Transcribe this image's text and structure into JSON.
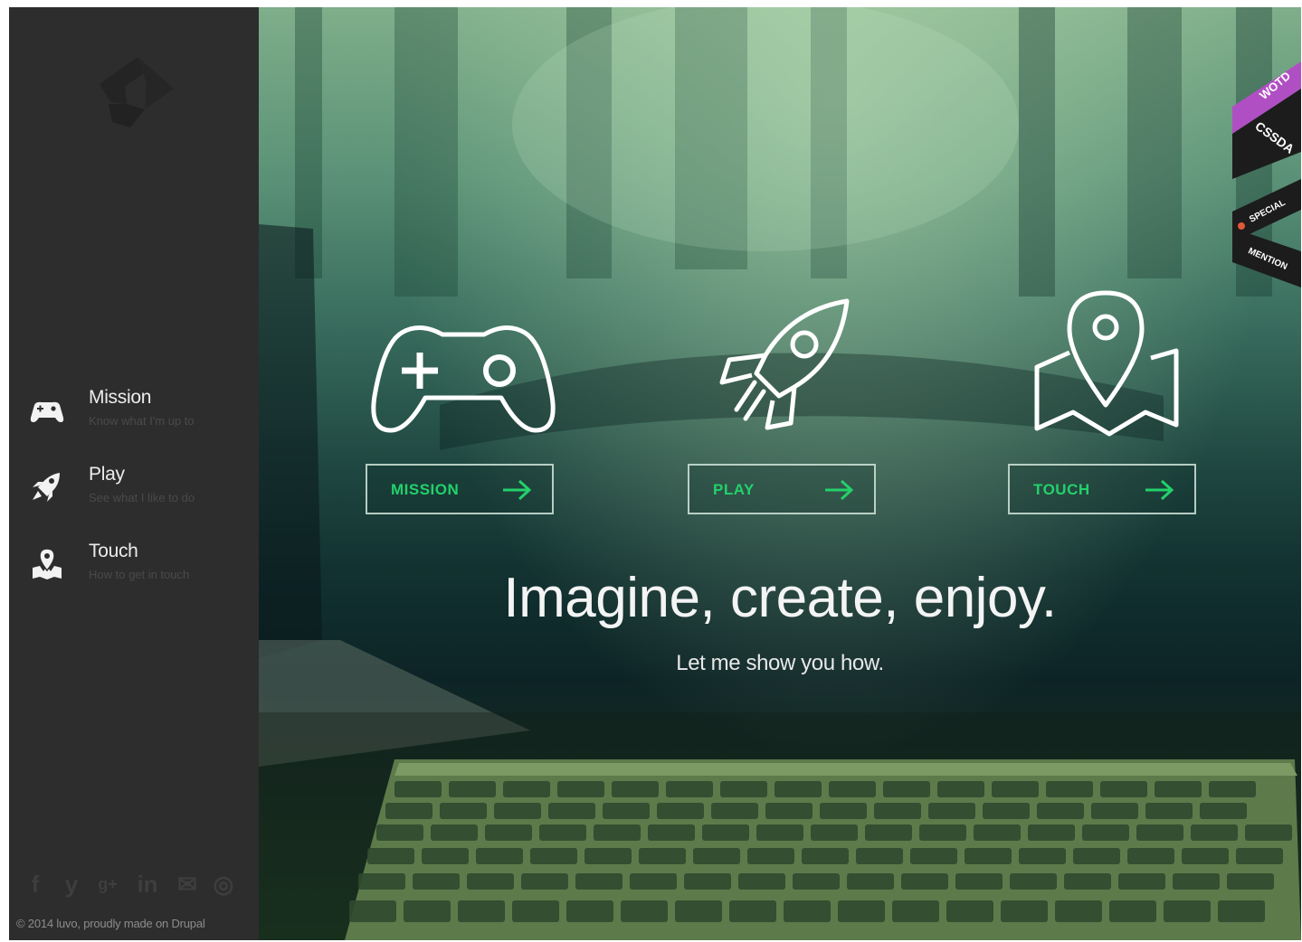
{
  "sidebar": {
    "nav": [
      {
        "label": "Mission",
        "sub": "Know what I'm up to",
        "icon": "gamepad-icon"
      },
      {
        "label": "Play",
        "sub": "See what I like to do",
        "icon": "rocket-icon"
      },
      {
        "label": "Touch",
        "sub": "How to get in touch",
        "icon": "map-pin-icon"
      }
    ],
    "social": [
      "f",
      "y",
      "g+",
      "in",
      "✉",
      "◎"
    ],
    "copyright": "© 2014 luvo, proudly made on Drupal"
  },
  "hero": {
    "ctas": [
      {
        "label": "MISSION"
      },
      {
        "label": "PLAY"
      },
      {
        "label": "TOUCH"
      }
    ],
    "headline": "Imagine, create, enjoy.",
    "subline": "Let me show you how."
  },
  "ribbons": {
    "award_1": "WOTD",
    "award_2": "CSSDA",
    "award_3": "SPECIAL",
    "award_4": "MENTION"
  },
  "colors": {
    "sidebar_bg": "#2d2d2d",
    "accent_green": "#22d16b",
    "ribbon_purple": "#b04fc4"
  }
}
